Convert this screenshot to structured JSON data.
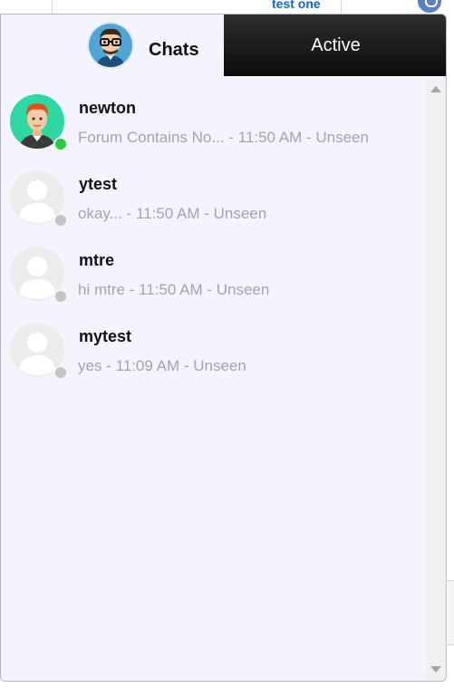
{
  "background": {
    "link_text": "test one"
  },
  "tabs": {
    "chats_label": "Chats",
    "active_label": "Active"
  },
  "conversations": [
    {
      "name": "newton",
      "message": "Forum Contains No... - 11:50 AM - Unseen",
      "status": "online",
      "avatar": "cartoon-man-red-hair"
    },
    {
      "name": "ytest",
      "message": "okay... - 11:50 AM - Unseen",
      "status": "offline",
      "avatar": "default-user"
    },
    {
      "name": "mtre",
      "message": "hi mtre - 11:50 AM - Unseen",
      "status": "offline",
      "avatar": "default-user"
    },
    {
      "name": "mytest",
      "message": "yes - 11:09 AM - Unseen",
      "status": "offline",
      "avatar": "default-user"
    }
  ],
  "colors": {
    "panel_bg": "#f4f4ff",
    "active_tab_bg": "#1a1a1a",
    "online": "#2ecc40",
    "offline": "#c4c4c4",
    "muted_text": "#a4a4ac"
  }
}
